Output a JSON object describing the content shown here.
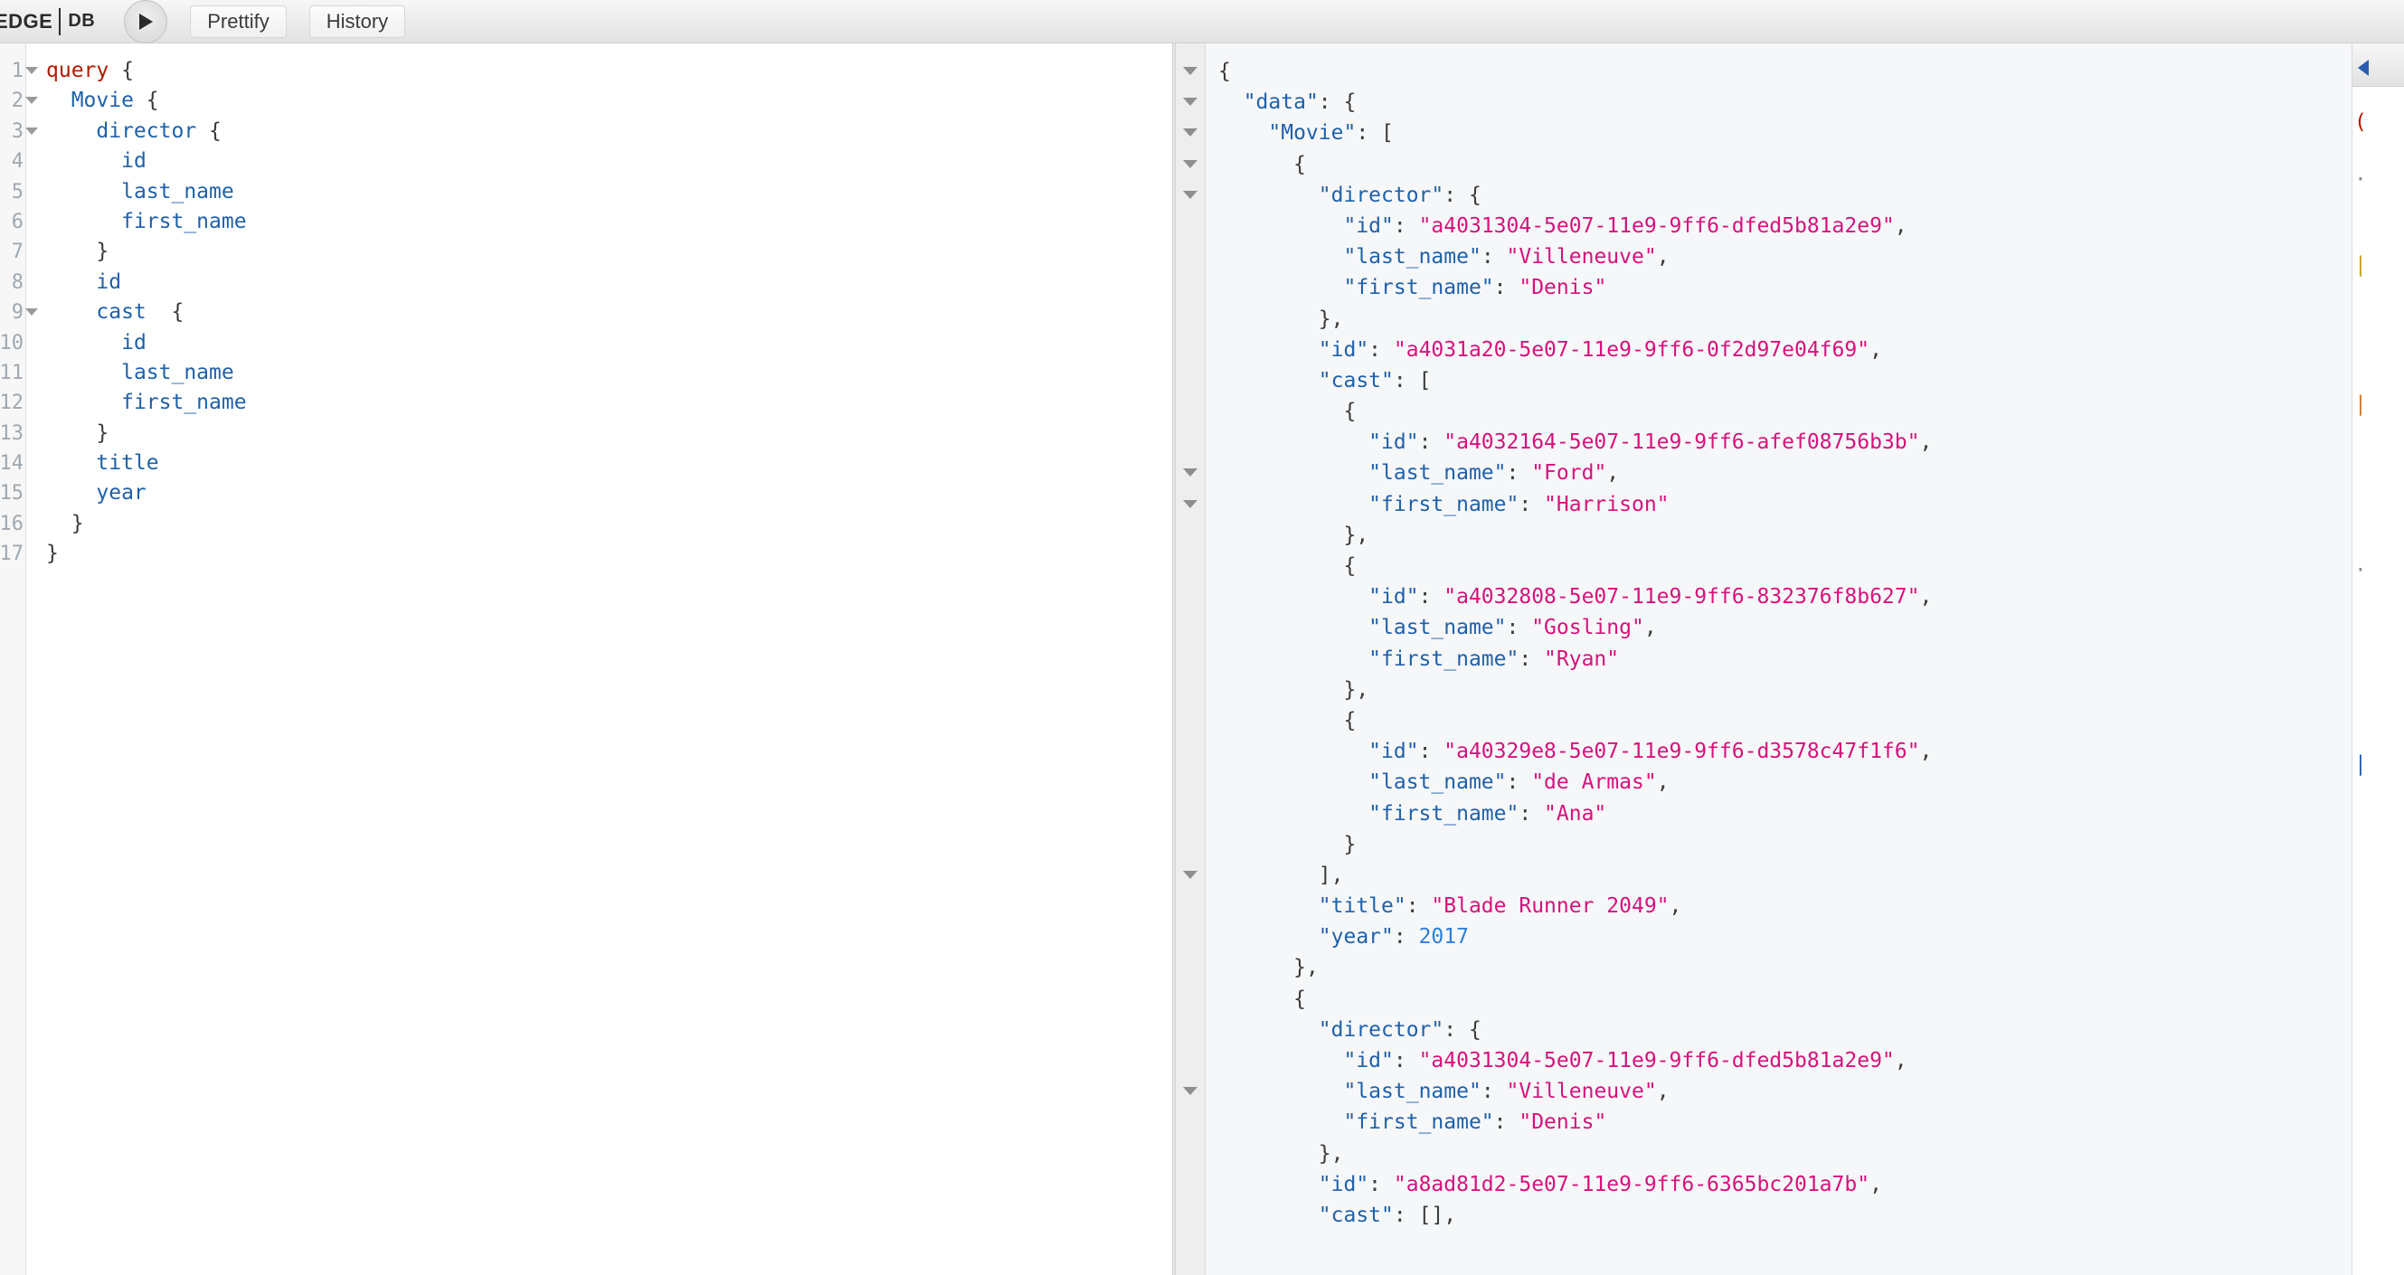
{
  "toolbar": {
    "logo_edge": "EDGE",
    "logo_db": "DB",
    "execute_label": "▶",
    "prettify_label": "Prettify",
    "history_label": "History"
  },
  "query_editor": {
    "line_numbers": [
      "1",
      "2",
      "3",
      "4",
      "5",
      "6",
      "7",
      "8",
      "9",
      "10",
      "11",
      "12",
      "13",
      "14",
      "15",
      "16",
      "17"
    ],
    "fold_lines": [
      1,
      2,
      3,
      9
    ],
    "lines": [
      {
        "n": 1,
        "indent": 0,
        "tokens": [
          {
            "t": "query",
            "c": "k-query"
          },
          {
            "t": " {",
            "c": "k-punct"
          }
        ]
      },
      {
        "n": 2,
        "indent": 1,
        "tokens": [
          {
            "t": "Movie",
            "c": "k-field"
          },
          {
            "t": " {",
            "c": "k-punct"
          }
        ]
      },
      {
        "n": 3,
        "indent": 2,
        "tokens": [
          {
            "t": "director",
            "c": "k-field"
          },
          {
            "t": " {",
            "c": "k-punct"
          }
        ]
      },
      {
        "n": 4,
        "indent": 3,
        "tokens": [
          {
            "t": "id",
            "c": "k-field"
          }
        ]
      },
      {
        "n": 5,
        "indent": 3,
        "tokens": [
          {
            "t": "last_name",
            "c": "k-field"
          }
        ]
      },
      {
        "n": 6,
        "indent": 3,
        "tokens": [
          {
            "t": "first_name",
            "c": "k-field"
          }
        ]
      },
      {
        "n": 7,
        "indent": 2,
        "tokens": [
          {
            "t": "}",
            "c": "k-punct"
          }
        ]
      },
      {
        "n": 8,
        "indent": 2,
        "tokens": [
          {
            "t": "id",
            "c": "k-field"
          }
        ]
      },
      {
        "n": 9,
        "indent": 2,
        "tokens": [
          {
            "t": "cast",
            "c": "k-field"
          },
          {
            "t": "  {",
            "c": "k-punct"
          }
        ]
      },
      {
        "n": 10,
        "indent": 3,
        "tokens": [
          {
            "t": "id",
            "c": "k-field"
          }
        ]
      },
      {
        "n": 11,
        "indent": 3,
        "tokens": [
          {
            "t": "last_name",
            "c": "k-field"
          }
        ]
      },
      {
        "n": 12,
        "indent": 3,
        "tokens": [
          {
            "t": "first_name",
            "c": "k-field"
          }
        ]
      },
      {
        "n": 13,
        "indent": 2,
        "tokens": [
          {
            "t": "}",
            "c": "k-punct"
          }
        ]
      },
      {
        "n": 14,
        "indent": 2,
        "tokens": [
          {
            "t": "title",
            "c": "k-field"
          }
        ]
      },
      {
        "n": 15,
        "indent": 2,
        "tokens": [
          {
            "t": "year",
            "c": "k-field"
          }
        ]
      },
      {
        "n": 16,
        "indent": 1,
        "tokens": [
          {
            "t": "}",
            "c": "k-punct"
          }
        ]
      },
      {
        "n": 17,
        "indent": 0,
        "tokens": [
          {
            "t": "}",
            "c": "k-punct"
          }
        ]
      }
    ],
    "raw_text": "query {\n  Movie {\n    director {\n      id\n      last_name\n      first_name\n    }\n    id\n    cast  {\n      id\n      last_name\n      first_name\n    }\n    title\n    year\n  }\n}"
  },
  "result_viewer": {
    "fold_line_indices": [
      0,
      1,
      2,
      3,
      4,
      13,
      14,
      26,
      33
    ],
    "lines": [
      {
        "i": 0,
        "indent": 0,
        "tokens": [
          {
            "t": "{",
            "c": "j-punct"
          }
        ]
      },
      {
        "i": 1,
        "indent": 1,
        "tokens": [
          {
            "t": "\"data\"",
            "c": "j-key"
          },
          {
            "t": ": {",
            "c": "j-punct"
          }
        ]
      },
      {
        "i": 2,
        "indent": 2,
        "tokens": [
          {
            "t": "\"Movie\"",
            "c": "j-key"
          },
          {
            "t": ": [",
            "c": "j-punct"
          }
        ]
      },
      {
        "i": 3,
        "indent": 3,
        "tokens": [
          {
            "t": "{",
            "c": "j-punct"
          }
        ]
      },
      {
        "i": 4,
        "indent": 4,
        "tokens": [
          {
            "t": "\"director\"",
            "c": "j-key"
          },
          {
            "t": ": {",
            "c": "j-punct"
          }
        ]
      },
      {
        "i": 5,
        "indent": 5,
        "tokens": [
          {
            "t": "\"id\"",
            "c": "j-key"
          },
          {
            "t": ": ",
            "c": "j-punct"
          },
          {
            "t": "\"a4031304-5e07-11e9-9ff6-dfed5b81a2e9\"",
            "c": "j-str"
          },
          {
            "t": ",",
            "c": "j-punct"
          }
        ]
      },
      {
        "i": 6,
        "indent": 5,
        "tokens": [
          {
            "t": "\"last_name\"",
            "c": "j-key"
          },
          {
            "t": ": ",
            "c": "j-punct"
          },
          {
            "t": "\"Villeneuve\"",
            "c": "j-str"
          },
          {
            "t": ",",
            "c": "j-punct"
          }
        ]
      },
      {
        "i": 7,
        "indent": 5,
        "tokens": [
          {
            "t": "\"first_name\"",
            "c": "j-key"
          },
          {
            "t": ": ",
            "c": "j-punct"
          },
          {
            "t": "\"Denis\"",
            "c": "j-str"
          }
        ]
      },
      {
        "i": 8,
        "indent": 4,
        "tokens": [
          {
            "t": "},",
            "c": "j-punct"
          }
        ]
      },
      {
        "i": 9,
        "indent": 4,
        "tokens": [
          {
            "t": "\"id\"",
            "c": "j-key"
          },
          {
            "t": ": ",
            "c": "j-punct"
          },
          {
            "t": "\"a4031a20-5e07-11e9-9ff6-0f2d97e04f69\"",
            "c": "j-str"
          },
          {
            "t": ",",
            "c": "j-punct"
          }
        ]
      },
      {
        "i": 10,
        "indent": 4,
        "tokens": [
          {
            "t": "\"cast\"",
            "c": "j-key"
          },
          {
            "t": ": [",
            "c": "j-punct"
          }
        ]
      },
      {
        "i": 11,
        "indent": 5,
        "tokens": [
          {
            "t": "{",
            "c": "j-punct"
          }
        ]
      },
      {
        "i": 12,
        "indent": 6,
        "tokens": [
          {
            "t": "\"id\"",
            "c": "j-key"
          },
          {
            "t": ": ",
            "c": "j-punct"
          },
          {
            "t": "\"a4032164-5e07-11e9-9ff6-afef08756b3b\"",
            "c": "j-str"
          },
          {
            "t": ",",
            "c": "j-punct"
          }
        ]
      },
      {
        "i": 13,
        "indent": 6,
        "tokens": [
          {
            "t": "\"last_name\"",
            "c": "j-key"
          },
          {
            "t": ": ",
            "c": "j-punct"
          },
          {
            "t": "\"Ford\"",
            "c": "j-str"
          },
          {
            "t": ",",
            "c": "j-punct"
          }
        ]
      },
      {
        "i": 14,
        "indent": 6,
        "tokens": [
          {
            "t": "\"first_name\"",
            "c": "j-key"
          },
          {
            "t": ": ",
            "c": "j-punct"
          },
          {
            "t": "\"Harrison\"",
            "c": "j-str"
          }
        ]
      },
      {
        "i": 15,
        "indent": 5,
        "tokens": [
          {
            "t": "},",
            "c": "j-punct"
          }
        ]
      },
      {
        "i": 16,
        "indent": 5,
        "tokens": [
          {
            "t": "{",
            "c": "j-punct"
          }
        ]
      },
      {
        "i": 17,
        "indent": 6,
        "tokens": [
          {
            "t": "\"id\"",
            "c": "j-key"
          },
          {
            "t": ": ",
            "c": "j-punct"
          },
          {
            "t": "\"a4032808-5e07-11e9-9ff6-832376f8b627\"",
            "c": "j-str"
          },
          {
            "t": ",",
            "c": "j-punct"
          }
        ]
      },
      {
        "i": 18,
        "indent": 6,
        "tokens": [
          {
            "t": "\"last_name\"",
            "c": "j-key"
          },
          {
            "t": ": ",
            "c": "j-punct"
          },
          {
            "t": "\"Gosling\"",
            "c": "j-str"
          },
          {
            "t": ",",
            "c": "j-punct"
          }
        ]
      },
      {
        "i": 19,
        "indent": 6,
        "tokens": [
          {
            "t": "\"first_name\"",
            "c": "j-key"
          },
          {
            "t": ": ",
            "c": "j-punct"
          },
          {
            "t": "\"Ryan\"",
            "c": "j-str"
          }
        ]
      },
      {
        "i": 20,
        "indent": 5,
        "tokens": [
          {
            "t": "},",
            "c": "j-punct"
          }
        ]
      },
      {
        "i": 21,
        "indent": 5,
        "tokens": [
          {
            "t": "{",
            "c": "j-punct"
          }
        ]
      },
      {
        "i": 22,
        "indent": 6,
        "tokens": [
          {
            "t": "\"id\"",
            "c": "j-key"
          },
          {
            "t": ": ",
            "c": "j-punct"
          },
          {
            "t": "\"a40329e8-5e07-11e9-9ff6-d3578c47f1f6\"",
            "c": "j-str"
          },
          {
            "t": ",",
            "c": "j-punct"
          }
        ]
      },
      {
        "i": 23,
        "indent": 6,
        "tokens": [
          {
            "t": "\"last_name\"",
            "c": "j-key"
          },
          {
            "t": ": ",
            "c": "j-punct"
          },
          {
            "t": "\"de Armas\"",
            "c": "j-str"
          },
          {
            "t": ",",
            "c": "j-punct"
          }
        ]
      },
      {
        "i": 24,
        "indent": 6,
        "tokens": [
          {
            "t": "\"first_name\"",
            "c": "j-key"
          },
          {
            "t": ": ",
            "c": "j-punct"
          },
          {
            "t": "\"Ana\"",
            "c": "j-str"
          }
        ]
      },
      {
        "i": 25,
        "indent": 5,
        "tokens": [
          {
            "t": "}",
            "c": "j-punct"
          }
        ]
      },
      {
        "i": 26,
        "indent": 4,
        "tokens": [
          {
            "t": "],",
            "c": "j-punct"
          }
        ]
      },
      {
        "i": 27,
        "indent": 4,
        "tokens": [
          {
            "t": "\"title\"",
            "c": "j-key"
          },
          {
            "t": ": ",
            "c": "j-punct"
          },
          {
            "t": "\"Blade Runner 2049\"",
            "c": "j-str"
          },
          {
            "t": ",",
            "c": "j-punct"
          }
        ]
      },
      {
        "i": 28,
        "indent": 4,
        "tokens": [
          {
            "t": "\"year\"",
            "c": "j-key"
          },
          {
            "t": ": ",
            "c": "j-punct"
          },
          {
            "t": "2017",
            "c": "j-num"
          }
        ]
      },
      {
        "i": 29,
        "indent": 3,
        "tokens": [
          {
            "t": "},",
            "c": "j-punct"
          }
        ]
      },
      {
        "i": 30,
        "indent": 3,
        "tokens": [
          {
            "t": "{",
            "c": "j-punct"
          }
        ]
      },
      {
        "i": 31,
        "indent": 4,
        "tokens": [
          {
            "t": "\"director\"",
            "c": "j-key"
          },
          {
            "t": ": {",
            "c": "j-punct"
          }
        ]
      },
      {
        "i": 32,
        "indent": 5,
        "tokens": [
          {
            "t": "\"id\"",
            "c": "j-key"
          },
          {
            "t": ": ",
            "c": "j-punct"
          },
          {
            "t": "\"a4031304-5e07-11e9-9ff6-dfed5b81a2e9\"",
            "c": "j-str"
          },
          {
            "t": ",",
            "c": "j-punct"
          }
        ]
      },
      {
        "i": 33,
        "indent": 5,
        "tokens": [
          {
            "t": "\"last_name\"",
            "c": "j-key"
          },
          {
            "t": ": ",
            "c": "j-punct"
          },
          {
            "t": "\"Villeneuve\"",
            "c": "j-str"
          },
          {
            "t": ",",
            "c": "j-punct"
          }
        ]
      },
      {
        "i": 34,
        "indent": 5,
        "tokens": [
          {
            "t": "\"first_name\"",
            "c": "j-key"
          },
          {
            "t": ": ",
            "c": "j-punct"
          },
          {
            "t": "\"Denis\"",
            "c": "j-str"
          }
        ]
      },
      {
        "i": 35,
        "indent": 4,
        "tokens": [
          {
            "t": "},",
            "c": "j-punct"
          }
        ]
      },
      {
        "i": 36,
        "indent": 4,
        "tokens": [
          {
            "t": "\"id\"",
            "c": "j-key"
          },
          {
            "t": ": ",
            "c": "j-punct"
          },
          {
            "t": "\"a8ad81d2-5e07-11e9-9ff6-6365bc201a7b\"",
            "c": "j-str"
          },
          {
            "t": ",",
            "c": "j-punct"
          }
        ]
      },
      {
        "i": 37,
        "indent": 4,
        "tokens": [
          {
            "t": "\"cast\"",
            "c": "j-key"
          },
          {
            "t": ": [],",
            "c": "j-punct"
          }
        ]
      }
    ]
  },
  "docs_panel": {
    "toggle_icon": "chevron-left-icon",
    "fragments": [
      "(",
      "·",
      "|",
      "|",
      "·",
      "|"
    ]
  },
  "colors": {
    "keyword_red": "#b11a04",
    "field_blue": "#1f61a9",
    "json_key_blue": "#1f61a9",
    "json_string_pink": "#d6127c",
    "json_number_blue": "#2a7fdb",
    "toolbar_bg": "#e8e8e8",
    "result_bg": "#f6f7f9",
    "gutter_bg": "#f7f7f7"
  }
}
